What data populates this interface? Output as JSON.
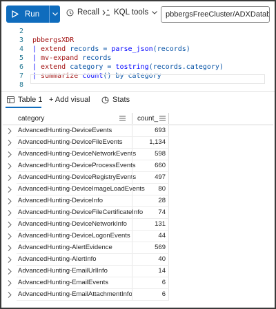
{
  "toolbar": {
    "run_label": "Run",
    "recall_label": "Recall",
    "kql_tools_label": "KQL tools",
    "cluster_database": "pbbergsFreeCluster/ADXDatabase"
  },
  "editor": {
    "lines": [
      {
        "num": "2",
        "parts": []
      },
      {
        "num": "3",
        "parts": [
          {
            "t": "pbbergsXDR",
            "c": "kw-db"
          }
        ]
      },
      {
        "num": "4",
        "parts": [
          {
            "t": "| ",
            "c": "pipe"
          },
          {
            "t": "extend",
            "c": "op"
          },
          {
            "t": " records = ",
            "c": "plain"
          },
          {
            "t": "parse_json",
            "c": "fn"
          },
          {
            "t": "(records)",
            "c": "plain"
          }
        ]
      },
      {
        "num": "5",
        "parts": [
          {
            "t": "| ",
            "c": "pipe"
          },
          {
            "t": "mv-expand",
            "c": "op"
          },
          {
            "t": " records",
            "c": "plain"
          }
        ]
      },
      {
        "num": "6",
        "parts": [
          {
            "t": "| ",
            "c": "pipe"
          },
          {
            "t": "extend",
            "c": "op"
          },
          {
            "t": " category = ",
            "c": "plain"
          },
          {
            "t": "tostring",
            "c": "fn"
          },
          {
            "t": "(records.category)",
            "c": "plain"
          }
        ]
      },
      {
        "num": "7",
        "parts": [
          {
            "t": "| ",
            "c": "pipe"
          },
          {
            "t": "summarize",
            "c": "op"
          },
          {
            "t": " ",
            "c": "plain"
          },
          {
            "t": "count",
            "c": "fn"
          },
          {
            "t": "() by category",
            "c": "plain"
          }
        ]
      },
      {
        "num": "8",
        "parts": []
      }
    ]
  },
  "results": {
    "tabs": [
      {
        "label": "Table 1",
        "icon": "table-icon"
      },
      {
        "label": "+ Add visual",
        "icon": ""
      },
      {
        "label": "Stats",
        "icon": "stats-icon"
      }
    ],
    "columns": [
      "category",
      "count_"
    ],
    "rows": [
      {
        "category": "AdvancedHunting-DeviceEvents",
        "count": "693"
      },
      {
        "category": "AdvancedHunting-DeviceFileEvents",
        "count": "1,134"
      },
      {
        "category": "AdvancedHunting-DeviceNetworkEvents",
        "count": "598"
      },
      {
        "category": "AdvancedHunting-DeviceProcessEvents",
        "count": "660"
      },
      {
        "category": "AdvancedHunting-DeviceRegistryEvents",
        "count": "497"
      },
      {
        "category": "AdvancedHunting-DeviceImageLoadEvents",
        "count": "80"
      },
      {
        "category": "AdvancedHunting-DeviceInfo",
        "count": "28"
      },
      {
        "category": "AdvancedHunting-DeviceFileCertificateInfo",
        "count": "74"
      },
      {
        "category": "AdvancedHunting-DeviceNetworkInfo",
        "count": "131"
      },
      {
        "category": "AdvancedHunting-DeviceLogonEvents",
        "count": "44"
      },
      {
        "category": "AdvancedHunting-AlertEvidence",
        "count": "569"
      },
      {
        "category": "AdvancedHunting-AlertInfo",
        "count": "40"
      },
      {
        "category": "AdvancedHunting-EmailUrlInfo",
        "count": "14"
      },
      {
        "category": "AdvancedHunting-EmailEvents",
        "count": "6"
      },
      {
        "category": "AdvancedHunting-EmailAttachmentInfo",
        "count": "6"
      }
    ]
  },
  "colors": {
    "accent": "#0f6cbd",
    "line_number": "#237893",
    "keyword": "#a31515",
    "function": "#0000ff"
  }
}
